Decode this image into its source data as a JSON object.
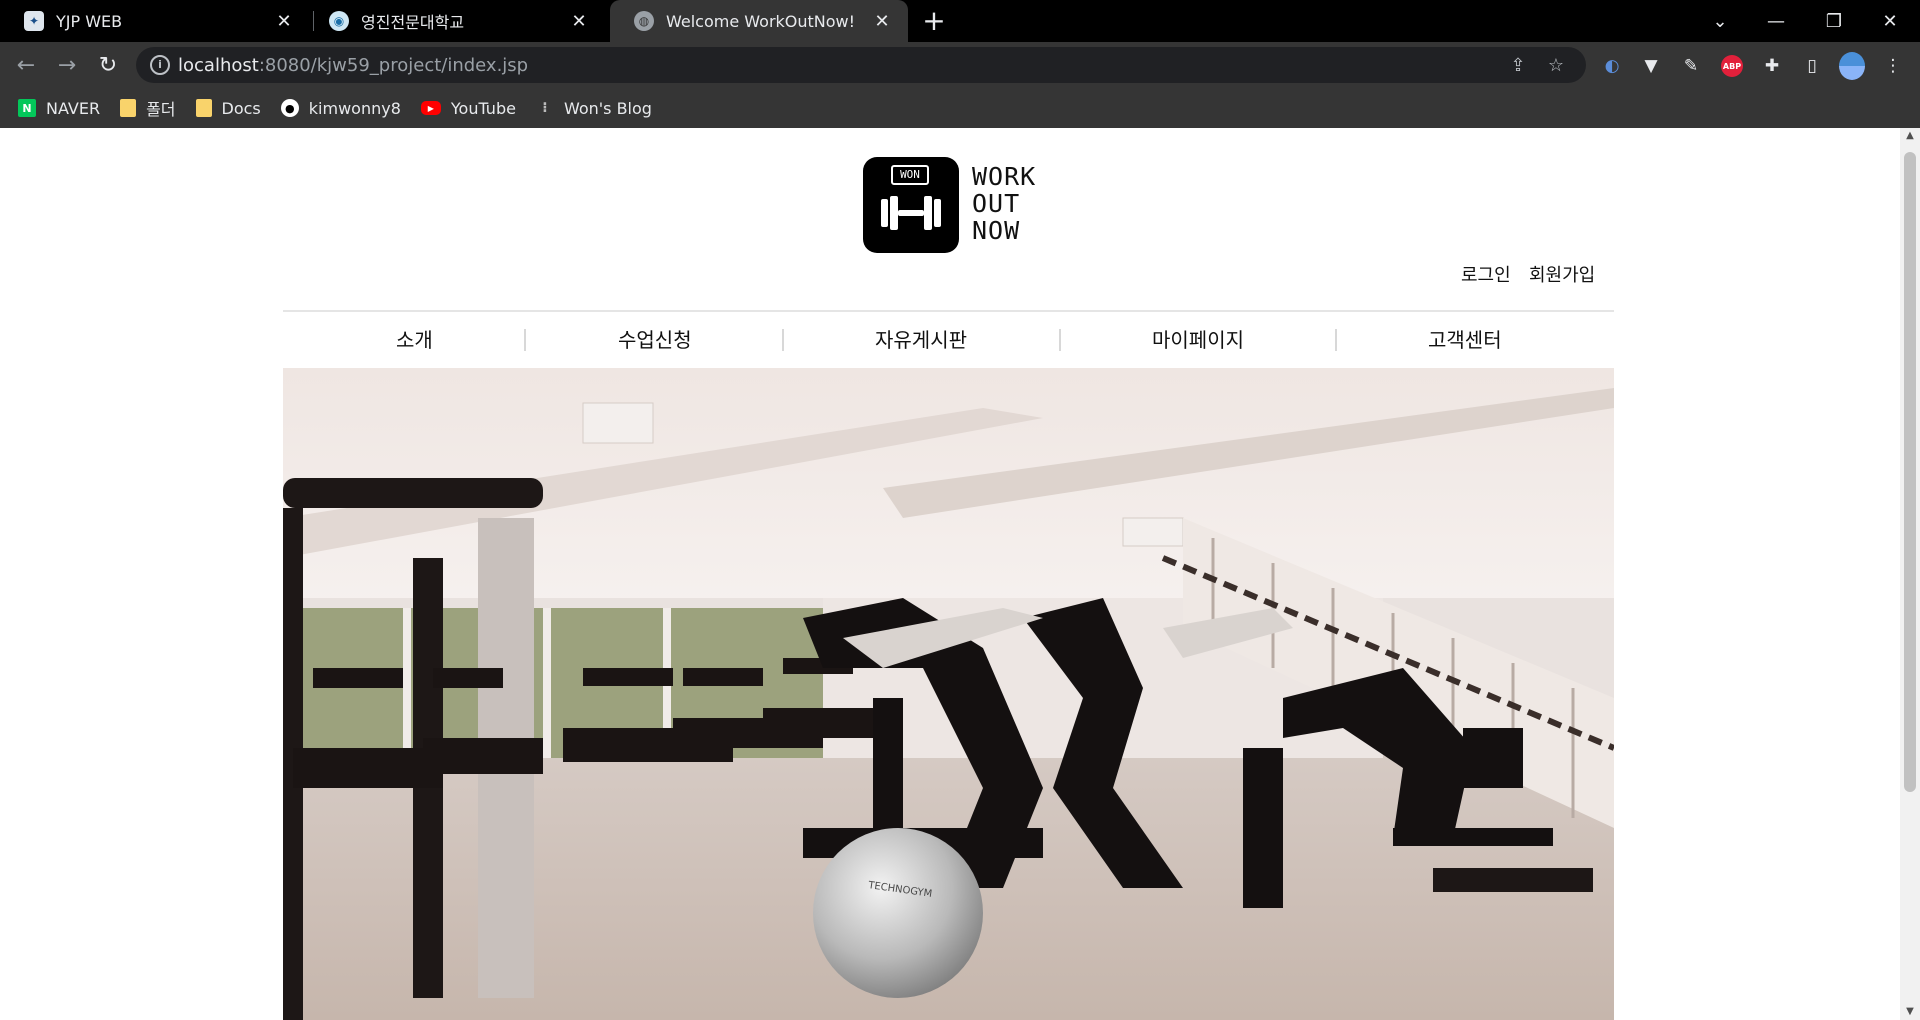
{
  "browser": {
    "tabs": [
      {
        "title": "YJP WEB",
        "favicon": "yjp-icon",
        "active": false
      },
      {
        "title": "영진전문대학교",
        "favicon": "yeungjin-icon",
        "active": false
      },
      {
        "title": "Welcome WorkOutNow!",
        "favicon": "globe-icon",
        "active": true
      }
    ],
    "new_tab_label": "+",
    "url_host": "localhost",
    "url_rest": ":8080/kjw59_project/index.jsp",
    "bookmarks": [
      {
        "label": "NAVER",
        "icon": "naver-icon",
        "color": "#03c75a"
      },
      {
        "label": "폴더",
        "icon": "folder-icon",
        "color": "#f9d36b"
      },
      {
        "label": "Docs",
        "icon": "folder-icon",
        "color": "#f9d36b"
      },
      {
        "label": "kimwonny8",
        "icon": "github-icon",
        "color": "#ffffff"
      },
      {
        "label": "YouTube",
        "icon": "youtube-icon",
        "color": "#ff0000"
      },
      {
        "label": "Won's Blog",
        "icon": "blog-icon",
        "color": "#888888"
      }
    ],
    "extension_abp": "ABP"
  },
  "site": {
    "logo_badge": "WON",
    "logo_text": [
      "WORK",
      "OUT",
      "NOW"
    ],
    "auth": {
      "login": "로그인",
      "signup": "회원가입"
    },
    "nav": [
      "소개",
      "수업신청",
      "자유게시판",
      "마이페이지",
      "고객센터"
    ],
    "hero_alt": "gym-photo"
  },
  "colors": {
    "chrome_dark": "#000000",
    "chrome_toolbar": "#353535",
    "page_bg": "#ffffff",
    "text": "#111111"
  }
}
